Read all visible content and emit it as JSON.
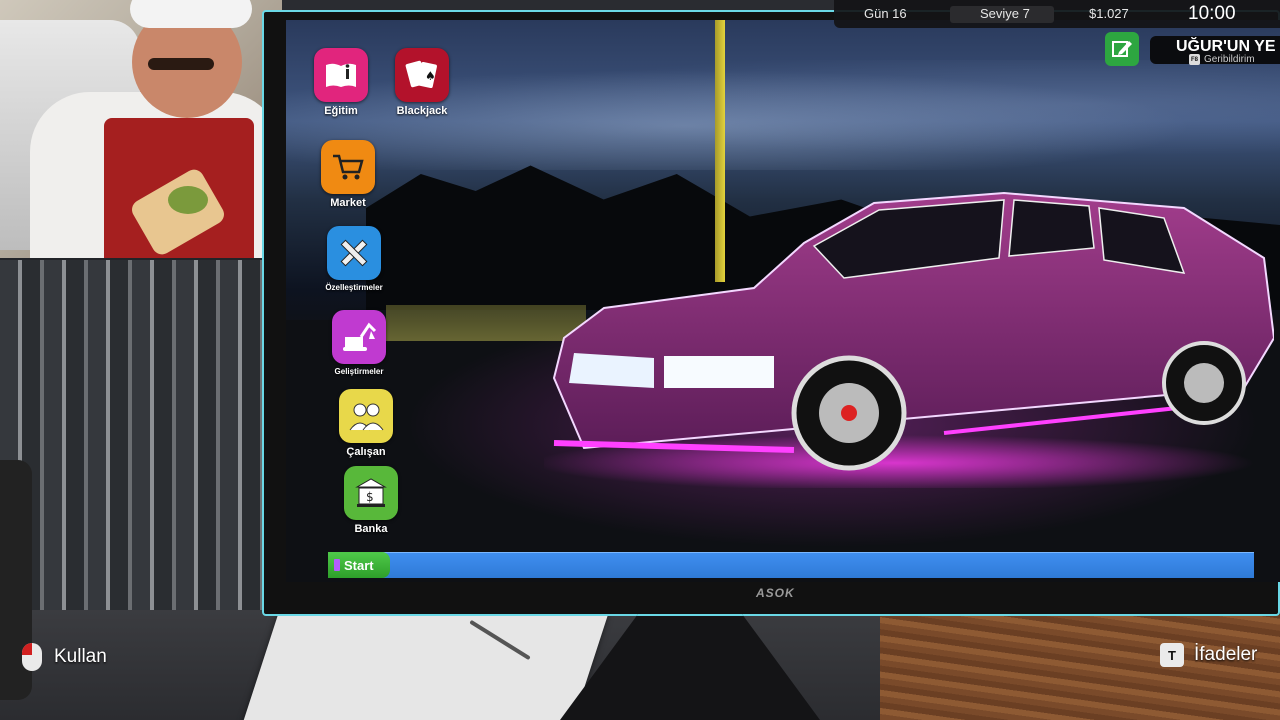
{
  "hud": {
    "day": "Gün 16",
    "level": "Seviye 7",
    "money": "$1.027",
    "time": "10:00"
  },
  "store_banner": {
    "title": "UĞUR'UN YE",
    "feedback_key": "F8",
    "feedback_label": "Geribildirim"
  },
  "desktop": {
    "icons": [
      {
        "label": "Eğitim",
        "icon": "book-info-icon",
        "color": "#e1257d"
      },
      {
        "label": "Blackjack",
        "icon": "playing-cards-icon",
        "color": "#b3122b"
      },
      {
        "label": "Market",
        "icon": "shopping-cart-icon",
        "color": "#f08a12"
      },
      {
        "label": "Özelleştirmeler",
        "icon": "pencil-ruler-icon",
        "color": "#2a8fe0"
      },
      {
        "label": "Geliştirmeler",
        "icon": "excavator-icon",
        "color": "#c03ad0"
      },
      {
        "label": "Çalışan",
        "icon": "employees-icon",
        "color": "#e8d84a"
      },
      {
        "label": "Banka",
        "icon": "bank-icon",
        "color": "#58b83a"
      }
    ],
    "taskbar": {
      "start_label": "Start"
    }
  },
  "monitor": {
    "brand": "ASOK"
  },
  "prompts": {
    "use": {
      "key_icon": "mouse-left-click-icon",
      "label": "Kullan"
    },
    "expressions": {
      "key": "T",
      "label": "İfadeler"
    }
  }
}
